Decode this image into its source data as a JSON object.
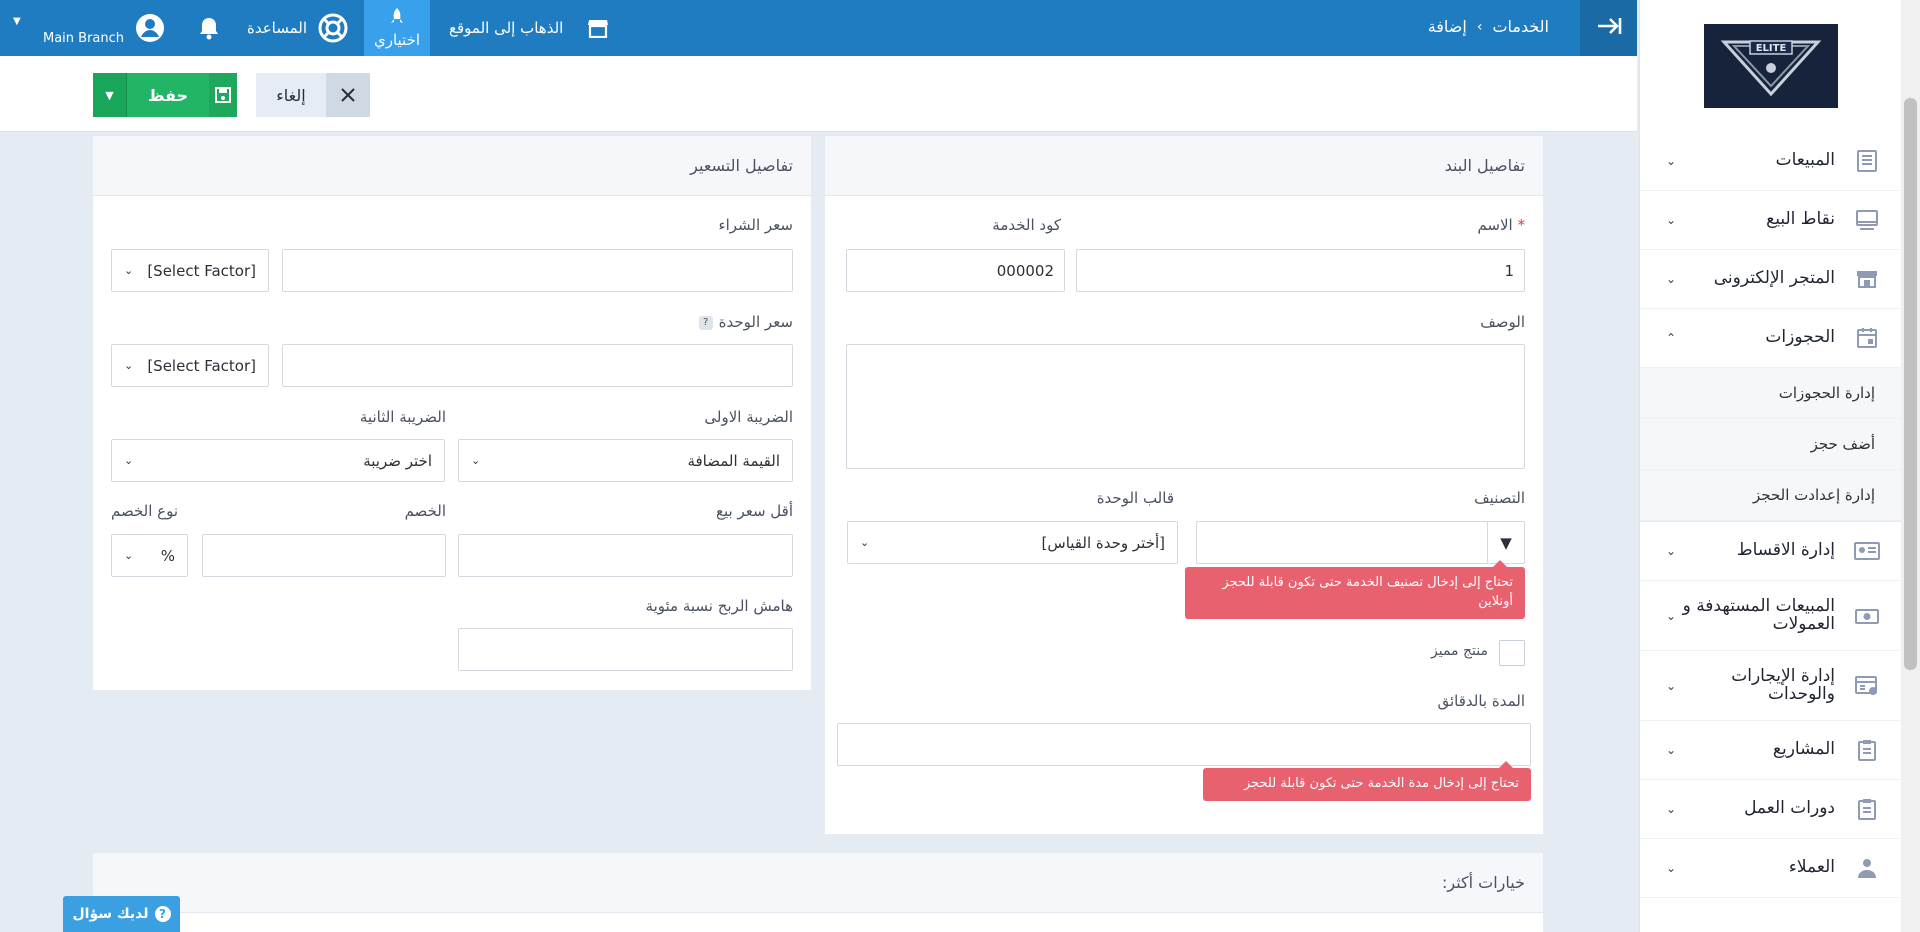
{
  "topbar": {
    "breadcrumb": [
      "الخدمات",
      "إضافة"
    ],
    "goto_site": "الذهاب إلى الموقع",
    "pick_label": "اختياري",
    "help_label": "المساعدة",
    "branch": "Main Branch"
  },
  "actions": {
    "save": "حفظ",
    "cancel": "إلغاء"
  },
  "item_details": {
    "title": "تفاصيل البند",
    "name_label": "الاسم",
    "name_required": "*",
    "name_value": "1",
    "code_label": "كود الخدمة",
    "code_value": "000002",
    "description_label": "الوصف",
    "category_label": "التصنيف",
    "category_value": "",
    "unit_template_label": "قالب الوحدة",
    "unit_template_value": "[أختر وحدة القياس]",
    "category_tip": "تحتاج إلى إدخال تصنيف الخدمة حتى تكون قابلة للحجز أونلاين",
    "featured_label": "منتج مميز",
    "duration_label": "المدة بالدقائق",
    "duration_tip": "تحتاج إلى إدخال مدة الخدمة حتى تكون قابلة للحجز"
  },
  "pricing": {
    "title": "تفاصيل التسعير",
    "purchase_price_label": "سعر الشراء",
    "purchase_factor": "[Select Factor]",
    "unit_price_label": "سعر الوحدة",
    "unit_factor": "[Select Factor]",
    "tax1_label": "الضريبة الاولى",
    "tax1_value": "القيمة المضافة",
    "tax2_label": "الضريبة الثانية",
    "tax2_value": "اختر ضريبة",
    "min_price_label": "أقل سعر بيع",
    "discount_label": "الخصم",
    "discount_type_label": "نوع الخصم",
    "discount_type_value": "%",
    "margin_label": "هامش الربح نسبة مئوية"
  },
  "more_options": {
    "title": "خيارات أكثر:"
  },
  "help_button": "لديك سؤال",
  "sidebar": {
    "items": [
      {
        "label": "المبيعات",
        "icon": "receipt-icon"
      },
      {
        "label": "نقاط البيع",
        "icon": "pos-icon"
      },
      {
        "label": "المتجر الإلكترونى",
        "icon": "store-icon"
      },
      {
        "label": "الحجوزات",
        "icon": "calendar-icon"
      },
      {
        "label": "إدارة الاقساط",
        "icon": "installments-icon"
      },
      {
        "label": "المبيعات المستهدفة و العمولات",
        "icon": "money-icon"
      },
      {
        "label": "إدارة الإيجارات والوحدات",
        "icon": "rental-icon"
      },
      {
        "label": "المشاريع",
        "icon": "clipboard-icon"
      },
      {
        "label": "دورات العمل",
        "icon": "workflow-icon"
      },
      {
        "label": "العملاء",
        "icon": "clients-icon"
      }
    ],
    "bookings_sub": [
      "إدارة الحجوزات",
      "أضف حجز",
      "إدارة إعدادت الحجز"
    ]
  }
}
